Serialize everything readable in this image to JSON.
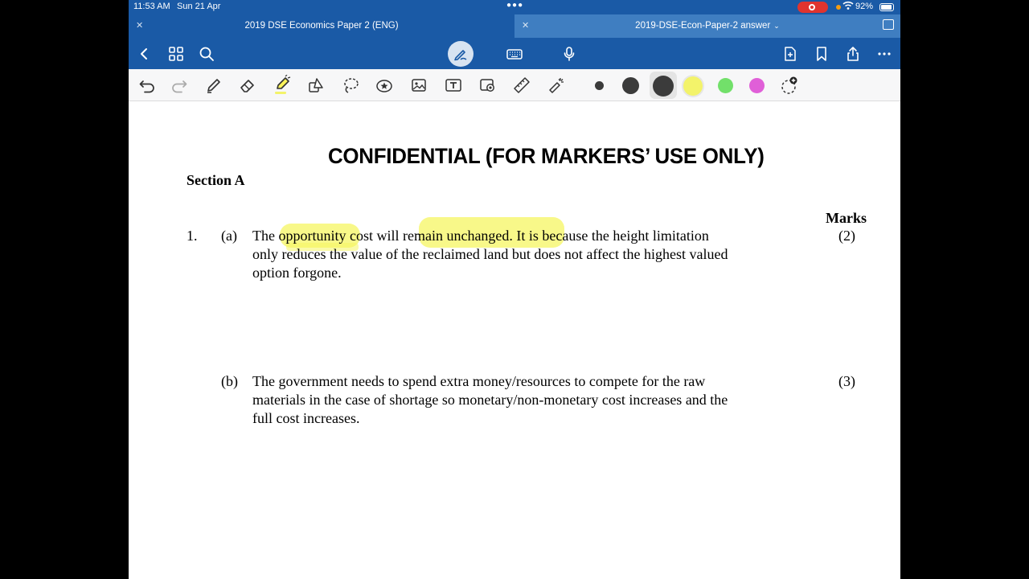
{
  "status": {
    "time": "11:53 AM",
    "date": "Sun 21 Apr",
    "battery": "92%"
  },
  "tabs": [
    {
      "title": "2019 DSE Economics Paper 2 (ENG)",
      "active": true
    },
    {
      "title": "2019-DSE-Econ-Paper-2 answer",
      "active": false
    }
  ],
  "toolbar": {
    "icons": [
      "undo-icon",
      "redo-icon",
      "pen-icon",
      "eraser-icon",
      "highlighter-icon",
      "shapes-icon",
      "lasso-icon",
      "elements-icon",
      "image-icon",
      "text-box-icon",
      "camera-image-icon",
      "ruler-icon",
      "laser-pointer-icon"
    ],
    "colors": [
      "#3b3b3b",
      "#3b3b3b",
      "#3b3b3b",
      "#f3f36a",
      "#72e06a",
      "#e05fd8"
    ],
    "selected_highlighter_color": "#f3f36a"
  },
  "document": {
    "heading": "CONFIDENTIAL (FOR MARKERS’ USE ONLY)",
    "section": "Section A",
    "marks_header": "Marks",
    "q1": {
      "number": "1.",
      "a": {
        "label": "(a)",
        "lines": [
          "The opportunity cost will remain unchanged.  It is because the height limitation",
          "only reduces the value of the reclaimed land but does not affect the highest valued",
          "option forgone."
        ],
        "marks": "(2)"
      },
      "b": {
        "label": "(b)",
        "lines": [
          "The government needs to spend extra money/resources to compete for the raw",
          "materials in the case of shortage so monetary/non-monetary cost increases and the",
          "full cost increases."
        ],
        "marks": "(3)"
      }
    }
  }
}
